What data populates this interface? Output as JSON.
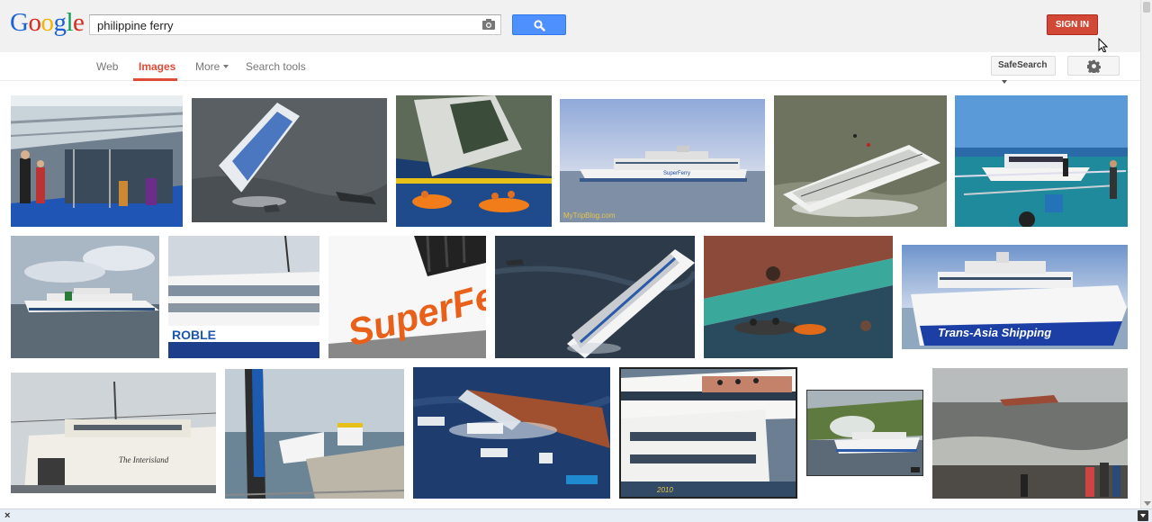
{
  "header": {
    "logo_letters": [
      {
        "ch": "G",
        "color": "#1a62d6"
      },
      {
        "ch": "o",
        "color": "#d62d20"
      },
      {
        "ch": "o",
        "color": "#f4b400"
      },
      {
        "ch": "g",
        "color": "#1a62d6"
      },
      {
        "ch": "l",
        "color": "#0f9d58"
      },
      {
        "ch": "e",
        "color": "#d62d20"
      }
    ],
    "search_value": "philippine ferry",
    "signin_label": "SIGN IN"
  },
  "nav": {
    "tabs": [
      {
        "label": "Web",
        "active": false
      },
      {
        "label": "Images",
        "active": true
      },
      {
        "label": "More",
        "active": false
      },
      {
        "label": "Search tools",
        "active": false
      }
    ],
    "safesearch_label": "SafeSearch"
  },
  "images": [
    {
      "row": 1,
      "subject": "ferry interior deck with passengers"
    },
    {
      "row": 1,
      "subject": "capsized ferry aerial view"
    },
    {
      "row": 1,
      "subject": "rescue boats near wreck"
    },
    {
      "row": 1,
      "subject": "SuperFerry at sea",
      "caption": "MyTripBlog.com"
    },
    {
      "row": 1,
      "subject": "sinking ferry in rough water"
    },
    {
      "row": 1,
      "subject": "outrigger boat with people"
    },
    {
      "row": 2,
      "subject": "white ferry on horizon"
    },
    {
      "row": 2,
      "subject": "ferry ROBLE docked"
    },
    {
      "row": 2,
      "subject": "SuperFerry hull logo",
      "logo_text": "SuperFerry"
    },
    {
      "row": 2,
      "subject": "listing ferry aerial"
    },
    {
      "row": 2,
      "subject": "rescue beside overturned hull"
    },
    {
      "row": 2,
      "subject": "Trans-Asia Shipping ferry",
      "hull_text": "Trans-Asia Shipping"
    },
    {
      "row": 3,
      "subject": "old ferry docked"
    },
    {
      "row": 3,
      "subject": "pier with ferry and bus"
    },
    {
      "row": 3,
      "subject": "capsized hull with debris"
    },
    {
      "row": 3,
      "subject": "ferries with passengers on deck",
      "caption": "2010"
    },
    {
      "row": 3,
      "subject": "ferry with smoke near coast"
    },
    {
      "row": 3,
      "subject": "beach with sunken ferry"
    }
  ],
  "colors": {
    "accent_red": "#dd4b39",
    "search_blue": "#4d90fe",
    "signin_red": "#d14836"
  }
}
